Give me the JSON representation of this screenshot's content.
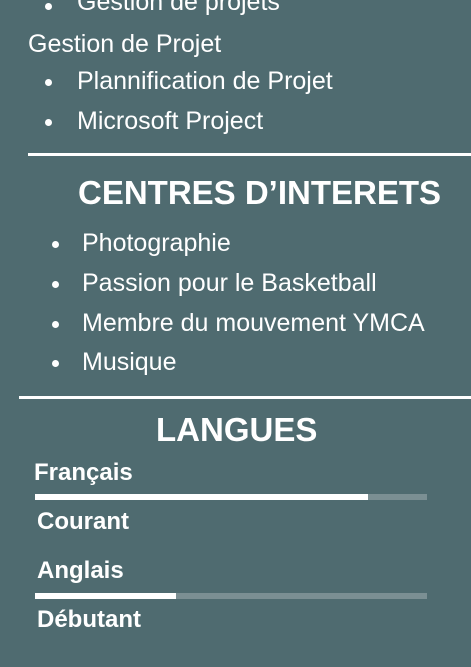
{
  "competences": {
    "top_partial_item": "Gestion de projets",
    "group_title": "Gestion de Projet",
    "items": [
      "Plannification de Projet",
      "Microsoft Project"
    ]
  },
  "interets": {
    "title": "CENTRES D’INTERETS",
    "items": [
      "Photographie",
      "Passion pour le Basketball",
      "Membre du mouvement YMCA",
      "Musique"
    ]
  },
  "langues": {
    "title": "LANGUES",
    "items": [
      {
        "name": "Français",
        "level": "Courant",
        "proficiency": 0.85
      },
      {
        "name": "Anglais",
        "level": "Débutant",
        "proficiency": 0.36
      }
    ]
  },
  "colors": {
    "background": "#4f6b70",
    "text": "#ffffff",
    "bar_track": "#7b8f93",
    "bar_fill": "#ffffff"
  }
}
